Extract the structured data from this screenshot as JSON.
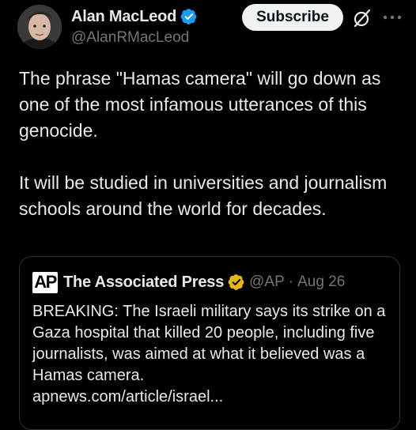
{
  "author": {
    "display_name": "Alan MacLeod",
    "handle": "@AlanRMacLeod",
    "verified_icon": "blue-verified-badge"
  },
  "actions": {
    "subscribe_label": "Subscribe",
    "grok_icon": "grok-icon",
    "more_icon": "more-dots-icon"
  },
  "tweet": {
    "text": "The phrase \"Hamas camera\" will go down as one of the most infamous utterances of this genocide.\n\nIt will be studied in universities and journalism schools around the world for decades."
  },
  "quote": {
    "logo_text": "AP",
    "display_name": "The Associated Press",
    "verified_icon": "gold-verified-badge",
    "handle": "@AP",
    "separator": "·",
    "date": "Aug 26",
    "body": "BREAKING: The Israeli military says its strike on a Gaza hospital that killed 20 people, including five journalists, was aimed at what it believed was a Hamas camera.",
    "link": "apnews.com/article/israel..."
  },
  "colors": {
    "background": "#000000",
    "text_primary": "#e7e9ea",
    "text_secondary": "#71767b",
    "verified_blue": "#1d9bf0",
    "verified_gold": "#e2b719",
    "border": "#2f3336"
  }
}
